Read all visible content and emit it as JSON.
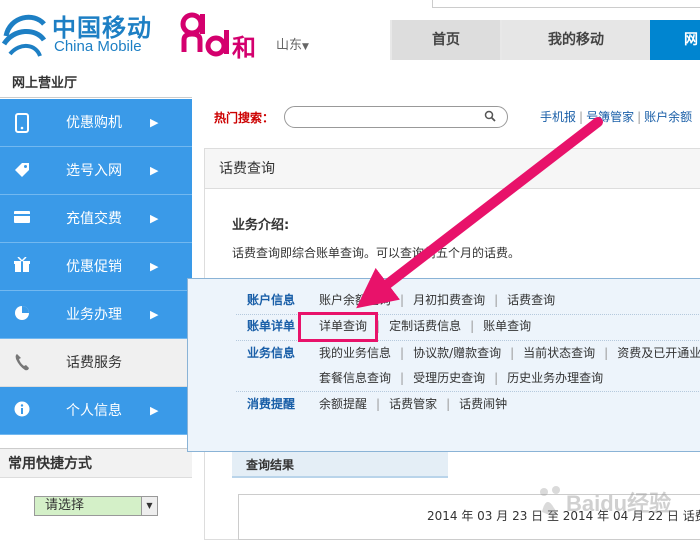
{
  "header": {
    "logo_cn": "中国移动",
    "logo_en": "China Mobile",
    "brand_he": "和",
    "region": "山东",
    "nav_tabs": [
      "首页",
      "我的移动",
      "网"
    ]
  },
  "sidebar": {
    "title": "网上营业厅",
    "items": [
      {
        "label": "优惠购机",
        "icon": "phone-icon"
      },
      {
        "label": "选号入网",
        "icon": "tag-icon"
      },
      {
        "label": "充值交费",
        "icon": "card-icon"
      },
      {
        "label": "优惠促销",
        "icon": "gift-icon"
      },
      {
        "label": "业务办理",
        "icon": "pie-icon"
      },
      {
        "label": "话费服务",
        "icon": "handset-icon",
        "active": true
      },
      {
        "label": "个人信息",
        "icon": "info-icon"
      }
    ],
    "shortcut_title": "常用快捷方式",
    "shortcut_select": "请选择"
  },
  "search": {
    "hot_label": "热门搜索：",
    "placeholder": "",
    "links": [
      "手机报",
      "号簿管家",
      "账户余额"
    ]
  },
  "panel": {
    "title": "话费查询",
    "intro_title": "业务介绍:",
    "intro_text": "话费查询即综合账单查询。可以查询前五个月的话费。",
    "result_tab": "查询结果",
    "date_range": "2014 年 03 月 23 日 至 2014 年 04 月 22 日 话费"
  },
  "popup": {
    "rows": [
      {
        "category": "账户信息",
        "items": [
          "账户余额查询",
          "月初扣费查询",
          "话费查询"
        ]
      },
      {
        "category": "账单详单",
        "items": [
          "详单查询",
          "定制话费信息",
          "账单查询"
        ]
      },
      {
        "category": "业务信息",
        "items": [
          "我的业务信息",
          "协议款/赠款查询",
          "当前状态查询",
          "资费及已开通业"
        ]
      },
      {
        "category": "",
        "items": [
          "套餐信息查询",
          "受理历史查询",
          "历史业务办理查询"
        ]
      },
      {
        "category": "消费提醒",
        "items": [
          "余额提醒",
          "话费管家",
          "话费闹钟"
        ]
      }
    ]
  },
  "colors": {
    "sidebar_blue": "#3a9ae8",
    "nav_active": "#0085d0",
    "highlight_pink": "#e8126a",
    "brand_blue": "#1d7fc4"
  },
  "watermark": "Baidu经验"
}
